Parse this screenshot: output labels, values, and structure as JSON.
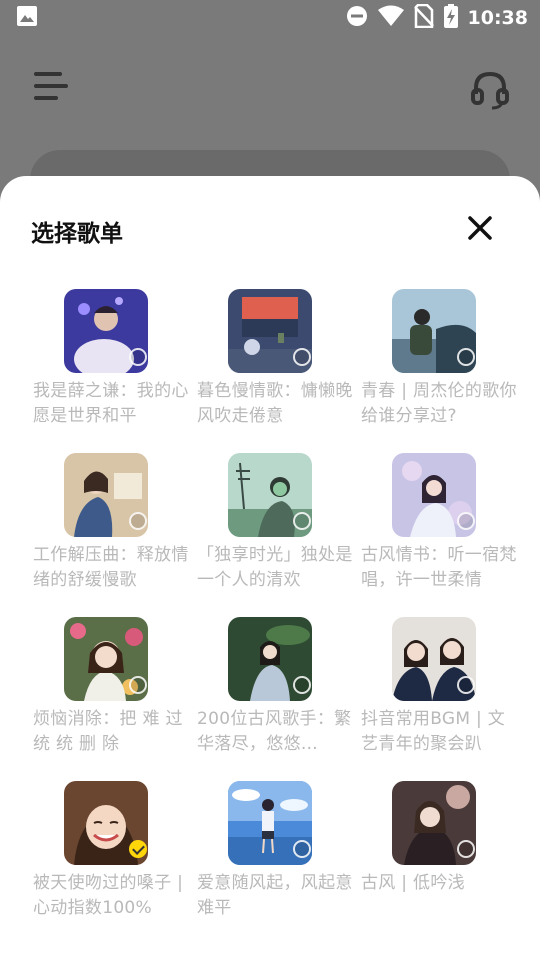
{
  "status_bar": {
    "time": "10:38",
    "icons": [
      "image-icon",
      "dnd-icon",
      "wifi-icon",
      "no-sim-icon",
      "battery-charging-icon"
    ]
  },
  "app_bar": {
    "menu_icon": "menu-icon",
    "headset_icon": "headset-icon"
  },
  "sheet": {
    "title": "选择歌单",
    "close_icon": "close-icon",
    "playlists": [
      {
        "title": "我是薛之谦：我的心愿是世界和平",
        "selected": false
      },
      {
        "title": "暮色慢情歌：慵懒晚风吹走倦意",
        "selected": false
      },
      {
        "title": "青春 | 周杰伦的歌你给谁分享过?",
        "selected": false
      },
      {
        "title": "工作解压曲：释放情绪的舒缓慢歌",
        "selected": false
      },
      {
        "title": "「独享时光」独处是一个人的清欢",
        "selected": false
      },
      {
        "title": "古风情书：听一宿梵唱，许一世柔情",
        "selected": false
      },
      {
        "title": "烦恼消除：把 难 过 统 统 删 除",
        "selected": false
      },
      {
        "title": "200位古风歌手：繁华落尽，悠悠…",
        "selected": false
      },
      {
        "title": "抖音常用BGM | 文艺青年的聚会趴",
        "selected": false
      },
      {
        "title": "被天使吻过的嗓子 | 心动指数100%",
        "selected": true
      },
      {
        "title": "爱意随风起，风起意难平",
        "selected": false
      },
      {
        "title": "古风 | 低吟浅",
        "selected": false
      }
    ]
  },
  "colors": {
    "overlay": "#7a7a7a",
    "sheet_bg": "#ffffff",
    "title_text": "#111111",
    "card_text": "#b9b9b9",
    "accent_check": "#ffd60a"
  }
}
